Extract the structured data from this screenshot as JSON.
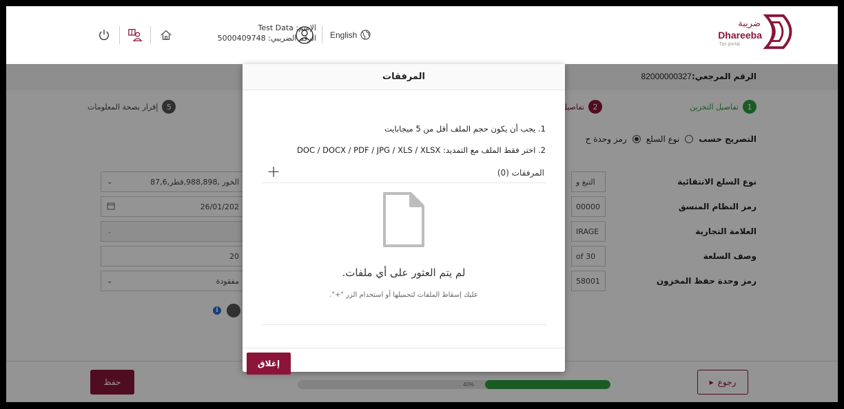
{
  "header": {
    "logo_ar": "ضريبة",
    "logo_en": "Dhareeba",
    "logo_sub": "Tax portal",
    "user_name_label": "الإسم: Test Data",
    "tax_number_label": "الرقم الضريبي: 5000409748",
    "language": "English"
  },
  "page": {
    "reference": "الرقم المرجعي:",
    "reference_number": "82000000327",
    "steps": [
      {
        "num": "1",
        "label": "تفاصيل التخزين"
      },
      {
        "num": "2",
        "label": "تفاصيل"
      },
      {
        "num": "5",
        "label": "إقرار بصحة المعلومات"
      }
    ],
    "declaration_label": "التصريح حسب",
    "declaration_option_goods": "نوع السلع",
    "declaration_option_unit": "رمز وحدة ح",
    "form_labels": [
      "نوع السلع الانتقائية",
      "رمز النظام المنسق",
      "العلامة التجارية",
      "وصف السلعة",
      "رمز وحدة حفظ المخزون"
    ],
    "left_fields": [
      "87,6,الخور ,988,898,قطر",
      "26/01/202",
      "",
      "20",
      "مفقودة"
    ],
    "mid_fields": [
      "التبغ و",
      "00000",
      "IRAGE",
      "of 30",
      "58001"
    ]
  },
  "footer": {
    "save_label": "حفظ",
    "back_label": "رجوع",
    "progress_label": "40%",
    "progress_value": 0.4
  },
  "modal": {
    "title": "المرفقات",
    "rule1": "1. يجب أن يكون حجم الملف أقل من 5 ميجابايت",
    "rule2": "2. اختر فقط الملف مع التمديد: DOC / DOCX / PDF / JPG / XLS / XLSX",
    "attachments_label": "المرفقات (0)",
    "add_symbol": "+",
    "empty_title": "لم يتم العثور على أي ملفات.",
    "empty_sub": "عليك إسقاط الملفات لتحميلها أو استخدام الزر \"+\".",
    "close_label": "إغلاق"
  },
  "colors": {
    "brand": "#8a1538",
    "progress": "#2e9e3e",
    "step_active": "#2e9e3e"
  }
}
